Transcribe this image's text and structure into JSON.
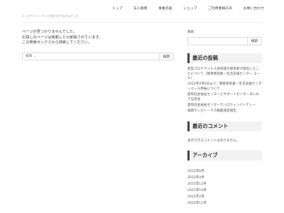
{
  "nav": {
    "items": [
      "トップ",
      "法人概要",
      "事業内容",
      "ショップ",
      "ご利用者様の声",
      "お問い合わせ"
    ]
  },
  "breadcrumb": "トップページ › ページが見つかりませんでした",
  "main": {
    "messages": [
      "ページが見つかりませんでした。",
      "お探しのページは移動したか削除されています。",
      "この検索ボックスから検索してください。"
    ],
    "search_placeholder": "検索 ...",
    "search_button": "検索"
  },
  "sidebar": {
    "search_label": "検索",
    "search_button": "検索",
    "recent_posts_title": "最近の投稿",
    "recent_posts": [
      "新型コロナウイルス感染症の感染者が発生したことについて（障害者就業・生活支援センター エール）",
      "2022年4月6日より、障害者就業・生活支援センターエール移転について",
      "愛和社会福祉センターとサポートセンターあいわで忘年会",
      "愛和社会福祉センターでハロウィンパーティー",
      "福岡テレビトーラス胸囲測定報告"
    ],
    "recent_comments_title": "最近のコメント",
    "no_comments": "表示できるコメントはありません。",
    "archive_title": "アーカイブ",
    "archives": [
      "2022年6月",
      "2022年4月",
      "2021年12月",
      "2021年10月",
      "2021年2月",
      "2020年11月"
    ]
  }
}
